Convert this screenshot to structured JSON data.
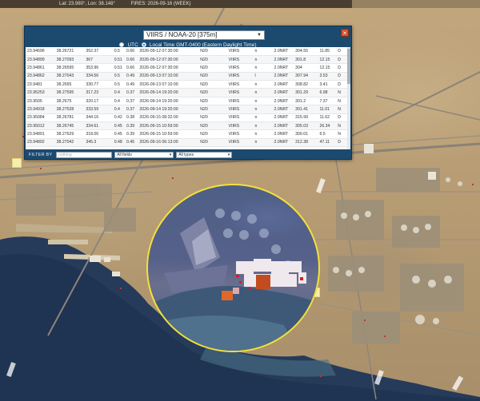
{
  "status_bar": {
    "coords": "Lat: 23.980°, Lon: 38.148°",
    "fires": "FIRES: 2026-09-16 (WEEK)"
  },
  "panel": {
    "sensor": "VIIRS / NOAA-20 [375m]",
    "close_glyph": "×",
    "time_utc": "UTC",
    "time_local": "Local Time GMT-0400 (Eastern Daylight Time)",
    "rows": [
      [
        "23.94696",
        "38.26721",
        "352.37",
        "0.5",
        "0.66",
        "2026-09-12 07:30:00",
        "N20",
        "VIIRS",
        "n",
        "2.0NRT",
        "304.55",
        "11.85",
        "D"
      ],
      [
        "23.94899",
        "38.27093",
        "367",
        "0.51",
        "0.66",
        "2026-09-12 07:30:00",
        "N20",
        "VIIRS",
        "n",
        "2.0NRT",
        "301.8",
        "12.15",
        "D"
      ],
      [
        "23.94861",
        "38.26595",
        "353.96",
        "0.51",
        "0.66",
        "2026-09-12 07:30:00",
        "N20",
        "VIIRS",
        "n",
        "2.0NRT",
        "304",
        "12.15",
        "D"
      ],
      [
        "23.94862",
        "38.27043",
        "334.56",
        "0.5",
        "0.49",
        "2026-09-13 07:10:00",
        "N20",
        "VIIRS",
        "l",
        "2.0NRT",
        "307.94",
        "3.53",
        "D"
      ],
      [
        "23.9481",
        "38.2655",
        "330.77",
        "0.5",
        "0.49",
        "2026-09-13 07:10:00",
        "N20",
        "VIIRS",
        "n",
        "2.0NRT",
        "308.82",
        "3.41",
        "D"
      ],
      [
        "23.95253",
        "38.27595",
        "317.23",
        "0.4",
        "0.37",
        "2026-09-14 19:20:00",
        "N20",
        "VIIRS",
        "n",
        "2.0NRT",
        "301.29",
        "6.98",
        "N"
      ],
      [
        "23.9505",
        "38.2675",
        "320.17",
        "0.4",
        "0.37",
        "2026-09-14 19:20:00",
        "N20",
        "VIIRS",
        "n",
        "2.0NRT",
        "301.2",
        "7.37",
        "N"
      ],
      [
        "23.94918",
        "38.27528",
        "333.59",
        "0.4",
        "0.37",
        "2026-09-14 19:20:00",
        "N20",
        "VIIRS",
        "n",
        "2.0NRT",
        "301.41",
        "11.01",
        "N"
      ],
      [
        "23.95084",
        "38.26781",
        "344.16",
        "0.42",
        "0.38",
        "2026-09-15 08:32:00",
        "N20",
        "VIIRS",
        "n",
        "2.0NRT",
        "315.99",
        "11.62",
        "D"
      ],
      [
        "23.95012",
        "38.26745",
        "334.61",
        "0.45",
        "0.39",
        "2026-09-15 10:59:00",
        "N20",
        "VIIRS",
        "n",
        "2.0NRT",
        "305.03",
        "26.34",
        "N"
      ],
      [
        "23.94891",
        "38.27629",
        "318.06",
        "0.45",
        "0.39",
        "2026-09-15 10:59:00",
        "N20",
        "VIIRS",
        "n",
        "2.0NRT",
        "300.01",
        "6.5",
        "N"
      ],
      [
        "23.94892",
        "38.27042",
        "345.3",
        "0.48",
        "0.45",
        "2026-09-16 06:13:00",
        "N20",
        "VIIRS",
        "n",
        "2.0NRT",
        "312.38",
        "47.11",
        "D"
      ]
    ],
    "filter_label": "FILTER BY",
    "filter_placeholder": "nothing",
    "filter_field": "All fields",
    "filter_types": "All types"
  },
  "colors": {
    "panel_bg": "#1c4a6e",
    "lens_border": "#f2e13a",
    "fire_orange": "#e0672a",
    "fire_red": "#d81b2b"
  }
}
